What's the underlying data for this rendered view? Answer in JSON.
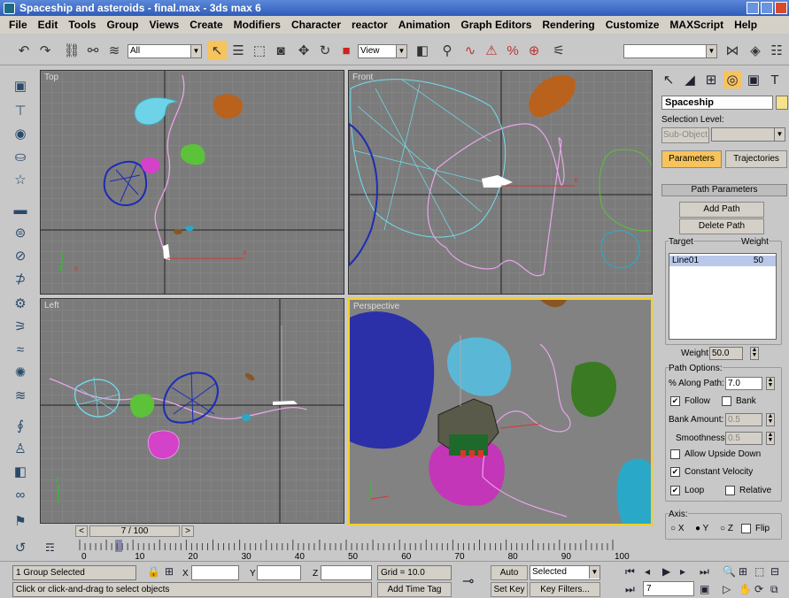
{
  "window": {
    "title": "Spaceship and asteroids - final.max - 3ds max 6"
  },
  "menu": [
    "File",
    "Edit",
    "Tools",
    "Group",
    "Views",
    "Create",
    "Modifiers",
    "Character",
    "reactor",
    "Animation",
    "Graph Editors",
    "Rendering",
    "Customize",
    "MAXScript",
    "Help"
  ],
  "toolbar": {
    "selection_filter": "All",
    "ref_coord": "View",
    "named_sel": ""
  },
  "viewports": {
    "top": "Top",
    "front": "Front",
    "left": "Left",
    "persp": "Perspective"
  },
  "command_panel": {
    "object_name": "Spaceship",
    "selection_level_label": "Selection Level:",
    "sub_object_label": "Sub-Object",
    "tab_parameters": "Parameters",
    "tab_trajectories": "Trajectories",
    "rollout_title": "Path Parameters",
    "add_path": "Add Path",
    "delete_path": "Delete Path",
    "target_header": "Target",
    "weight_header": "Weight",
    "targets": [
      {
        "name": "Line01",
        "weight": "50"
      }
    ],
    "weight_label": "Weight",
    "weight_value": "50.0",
    "path_options_label": "Path Options:",
    "along_path_label": "% Along Path:",
    "along_path_value": "7.0",
    "follow_label": "Follow",
    "bank_label": "Bank",
    "bank_amount_label": "Bank Amount:",
    "bank_amount_value": "0.5",
    "smoothness_label": "Smoothness:",
    "smoothness_value": "0.5",
    "allow_upside_down_label": "Allow Upside Down",
    "constant_velocity_label": "Constant Velocity",
    "loop_label": "Loop",
    "relative_label": "Relative",
    "axis_label": "Axis:",
    "axis_x": "X",
    "axis_y": "Y",
    "axis_z": "Z",
    "flip_label": "Flip",
    "follow_checked": true,
    "bank_checked": false,
    "allow_checked": false,
    "constvel_checked": true,
    "loop_checked": true,
    "relative_checked": false,
    "axis_selected": "Y"
  },
  "time": {
    "slider_label": "7 / 100",
    "ticks": [
      "0",
      "10",
      "20",
      "30",
      "40",
      "50",
      "60",
      "70",
      "80",
      "90",
      "100"
    ]
  },
  "status": {
    "selection": "1 Group Selected",
    "prompt": "Click or click-and-drag to select objects",
    "x_label": "X",
    "y_label": "Y",
    "z_label": "Z",
    "grid": "Grid = 10.0",
    "add_time_tag": "Add Time Tag",
    "auto_key": "Auto Key",
    "set_key": "Set Key",
    "selected_dropdown": "Selected",
    "key_filters": "Key Filters...",
    "frame": "7"
  }
}
